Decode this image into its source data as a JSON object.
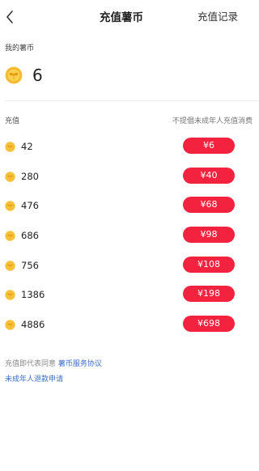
{
  "header": {
    "title": "充值薯币",
    "record_label": "充值记录"
  },
  "balance": {
    "label": "我的薯币",
    "value": "6"
  },
  "list": {
    "left_label": "充值",
    "right_label": "不提倡未成年人充值消费",
    "items": [
      {
        "amount": "42",
        "price": "¥6"
      },
      {
        "amount": "280",
        "price": "¥40"
      },
      {
        "amount": "476",
        "price": "¥68"
      },
      {
        "amount": "686",
        "price": "¥98"
      },
      {
        "amount": "756",
        "price": "¥108"
      },
      {
        "amount": "1386",
        "price": "¥198"
      },
      {
        "amount": "4886",
        "price": "¥698"
      }
    ]
  },
  "footer": {
    "agree_prefix": "充值即代表同意 ",
    "agree_link": "薯币服务协议",
    "refund_link": "未成年人退款申请"
  },
  "colors": {
    "price_button": "#f3233f",
    "coin": "#f7c23a",
    "link": "#3b6cc6"
  }
}
